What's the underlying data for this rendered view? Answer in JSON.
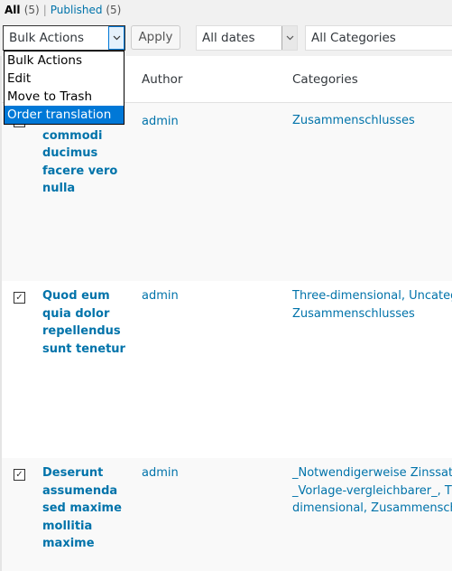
{
  "filters": {
    "all_label": "All",
    "all_count": "(5)",
    "separator": "|",
    "published_label": "Published",
    "published_count": "(5)"
  },
  "toolbar": {
    "bulk_actions_value": "Bulk Actions",
    "apply_label": "Apply",
    "dates_value": "All dates",
    "categories_value": "All Categories"
  },
  "bulk_dropdown": {
    "options": [
      "Bulk Actions",
      "Edit",
      "Move to Trash",
      "Order translation"
    ],
    "highlighted": "Order translation"
  },
  "table": {
    "columns": {
      "author": "Author",
      "categories": "Categories"
    },
    "rows": [
      {
        "title_lines": [
          "Eum commodi",
          "ducimus",
          "facere vero",
          "nulla"
        ],
        "author": "admin",
        "categories_lines": [
          "Zusammenschlusses"
        ],
        "checked": false
      },
      {
        "title_lines": [
          "Quod eum",
          "quia dolor",
          "repellendus",
          "sunt tenetur"
        ],
        "author": "admin",
        "categories_lines": [
          "Three-dimensional, Uncategor",
          "Zusammenschlusses"
        ],
        "checked": true
      },
      {
        "title_lines": [
          "Deserunt",
          "assumenda",
          "sed maxime",
          "mollitia",
          "maxime"
        ],
        "author": "admin",
        "categories_lines": [
          "_Notwendigerweise Zinssatz C",
          "_Vorlage-vergleichbarer_, Thre",
          "dimensional, Zusammenschlus"
        ],
        "checked": true
      }
    ]
  },
  "colors": {
    "link": "#0073aa",
    "highlight": "#0078d7"
  },
  "icons": {
    "checkmark": "✓",
    "chevron": "chevron-down-icon"
  }
}
